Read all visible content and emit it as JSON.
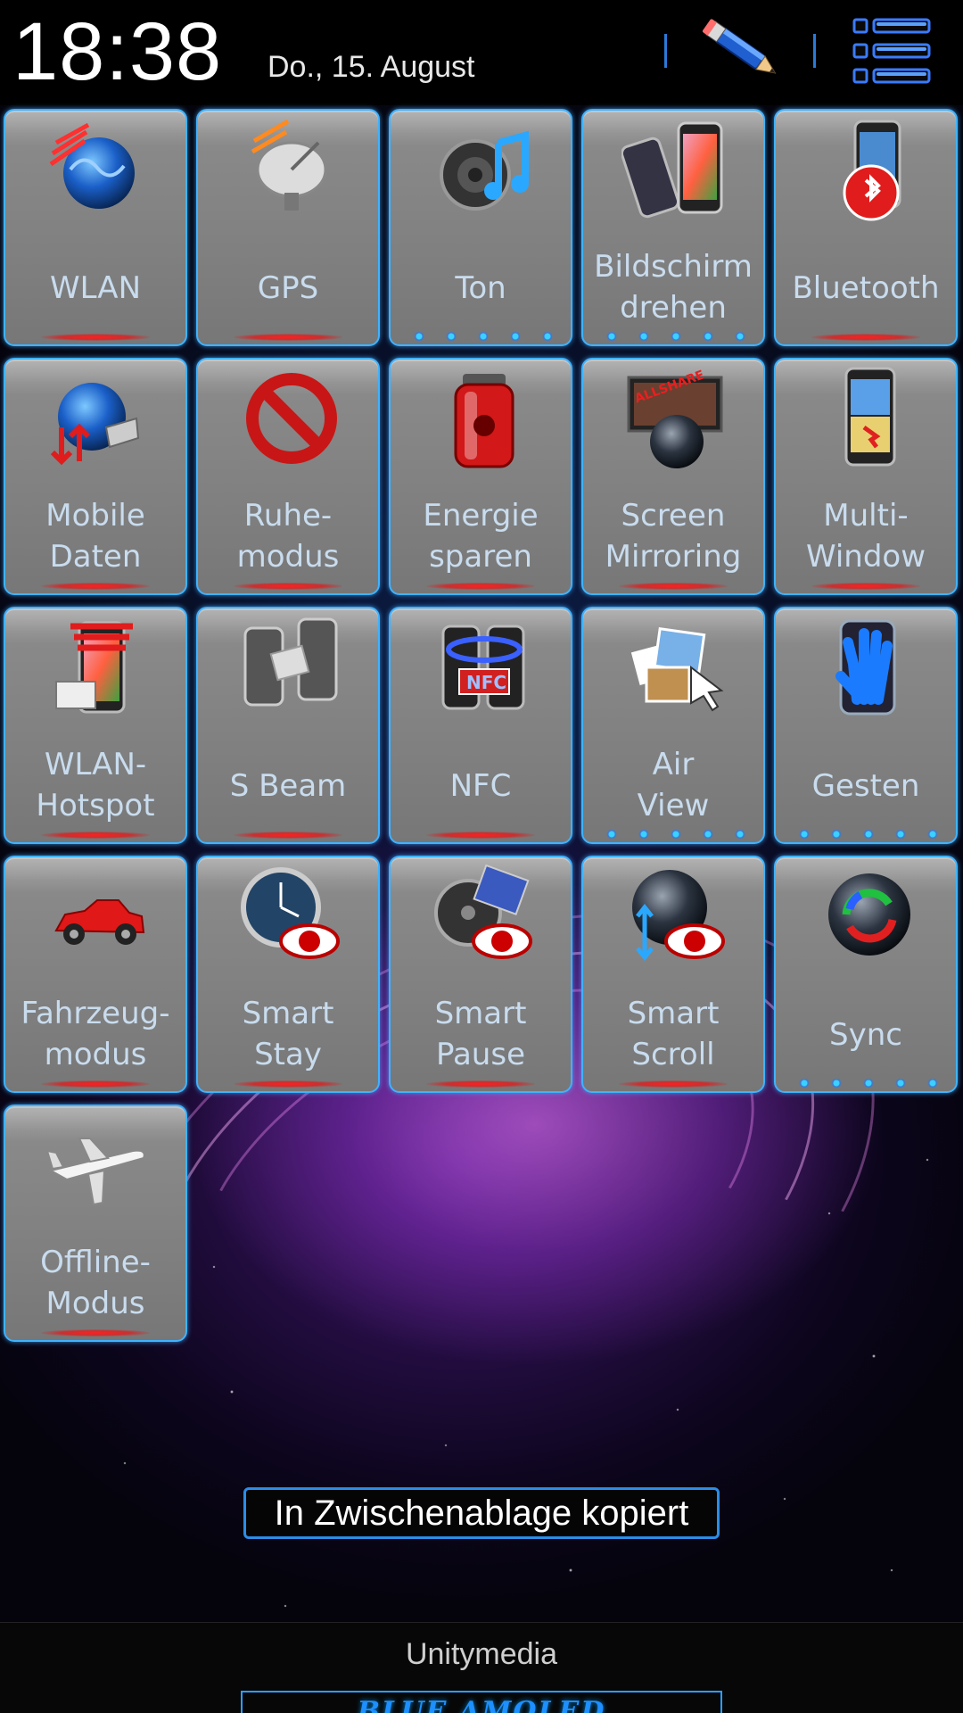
{
  "header": {
    "time": "18:38",
    "date": "Do., 15. August",
    "edit_icon": "pencil-icon",
    "menu_icon": "list-icon"
  },
  "tiles": [
    {
      "label": "WLAN",
      "icon": "wifi-globe-icon",
      "indicator": "red"
    },
    {
      "label": "GPS",
      "icon": "satellite-dish-icon",
      "indicator": "red"
    },
    {
      "label": "Ton",
      "icon": "speaker-music-icon",
      "indicator": "blue"
    },
    {
      "label": "Bildschirm\ndrehen",
      "icon": "screen-rotate-icon",
      "indicator": "blue"
    },
    {
      "label": "Bluetooth",
      "icon": "bluetooth-icon",
      "indicator": "red"
    },
    {
      "label": "Mobile\nDaten",
      "icon": "mobile-data-icon",
      "indicator": "red"
    },
    {
      "label": "Ruhe-\nmodus",
      "icon": "no-sign-icon",
      "indicator": "red"
    },
    {
      "label": "Energie\nsparen",
      "icon": "battery-icon",
      "indicator": "red"
    },
    {
      "label": "Screen\nMirroring",
      "icon": "screen-mirroring-icon",
      "indicator": "red"
    },
    {
      "label": "Multi-\nWindow",
      "icon": "multi-window-icon",
      "indicator": "red"
    },
    {
      "label": "WLAN-\nHotspot",
      "icon": "hotspot-icon",
      "indicator": "red"
    },
    {
      "label": "S Beam",
      "icon": "s-beam-icon",
      "indicator": "red"
    },
    {
      "label": "NFC",
      "icon": "nfc-icon",
      "indicator": "red"
    },
    {
      "label": "Air\nView",
      "icon": "air-view-icon",
      "indicator": "blue"
    },
    {
      "label": "Gesten",
      "icon": "hand-gesture-icon",
      "indicator": "blue"
    },
    {
      "label": "Fahrzeug-\nmodus",
      "icon": "car-icon",
      "indicator": "red"
    },
    {
      "label": "Smart\nStay",
      "icon": "smart-stay-eye-icon",
      "indicator": "red"
    },
    {
      "label": "Smart\nPause",
      "icon": "smart-pause-eye-icon",
      "indicator": "red"
    },
    {
      "label": "Smart\nScroll",
      "icon": "smart-scroll-eye-icon",
      "indicator": "red"
    },
    {
      "label": "Sync",
      "icon": "sync-icon",
      "indicator": "blue"
    },
    {
      "label": "Offline-\nModus",
      "icon": "airplane-icon",
      "indicator": "red"
    }
  ],
  "toast": "In Zwischenablage kopiert",
  "footer": {
    "carrier": "Unitymedia",
    "brand": "BLUE AMOLED"
  },
  "colors": {
    "tile_border": "#3fb3ff",
    "label_text": "#c9dcee",
    "active_red": "#ff2020",
    "accent_blue": "#2a8de8"
  }
}
